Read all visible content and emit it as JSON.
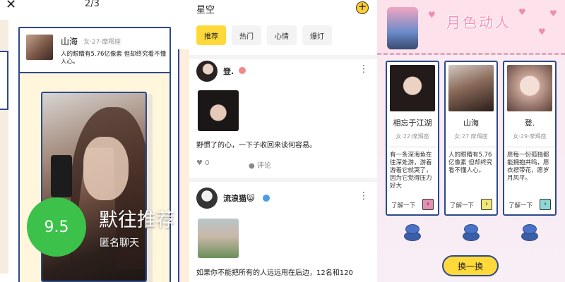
{
  "overlay": {
    "score": "9.5",
    "app_name": "默往推荐",
    "app_subtitle": "匿名聊天"
  },
  "panel_left": {
    "close_icon": "close-icon",
    "page_counter": "2/3",
    "profile": {
      "name": "山海",
      "meta": "女·27·摩羯座",
      "bio": "人的眼睛有5.76亿像素 但却终究看不懂人心。"
    }
  },
  "panel_middle": {
    "title": "星空",
    "add_icon": "plus-circle-icon",
    "tabs": [
      {
        "label": "推荐",
        "active": true
      },
      {
        "label": "热门",
        "active": false
      },
      {
        "label": "心情",
        "active": false
      },
      {
        "label": "爆灯",
        "active": false
      }
    ],
    "posts": [
      {
        "author": "登.",
        "text": "野惯了的心，一下子收回来谈何容易。",
        "likes": "0",
        "comment_label": "评论"
      },
      {
        "author": "流浪猫😸",
        "text": "如果你不能把所有的人远远甩在后边，12名和120"
      }
    ]
  },
  "panel_right": {
    "banner_title": "月色动人",
    "cards": [
      {
        "name": "相忘于江湖",
        "meta": "女·22·摩羯座",
        "bio": "有一条深海鱼在往深处游，游着游着它就哭了，因为它觉得压力好大",
        "more": "了解一下",
        "arrow_color": "#e68fb5"
      },
      {
        "name": "山海",
        "meta": "女·27·摩羯座",
        "bio": "人的眼睛有5.76亿像素 但却终究看不懂人心。",
        "more": "了解一下",
        "arrow_color": "#f2e87a"
      },
      {
        "name": "登.",
        "meta": "女·29·摩羯座",
        "bio": "愿每一份孤独都能拥抱共鸣，愿衣襟带花，愿岁月风平。",
        "more": "了解一下",
        "arrow_color": "#8fd6d6"
      }
    ],
    "swap_button": "换一换"
  },
  "colors": {
    "accent_yellow": "#ffd83a",
    "card_border": "#2d4a8a",
    "score_green": "#3cc24a",
    "pink": "#ff8fb3"
  }
}
